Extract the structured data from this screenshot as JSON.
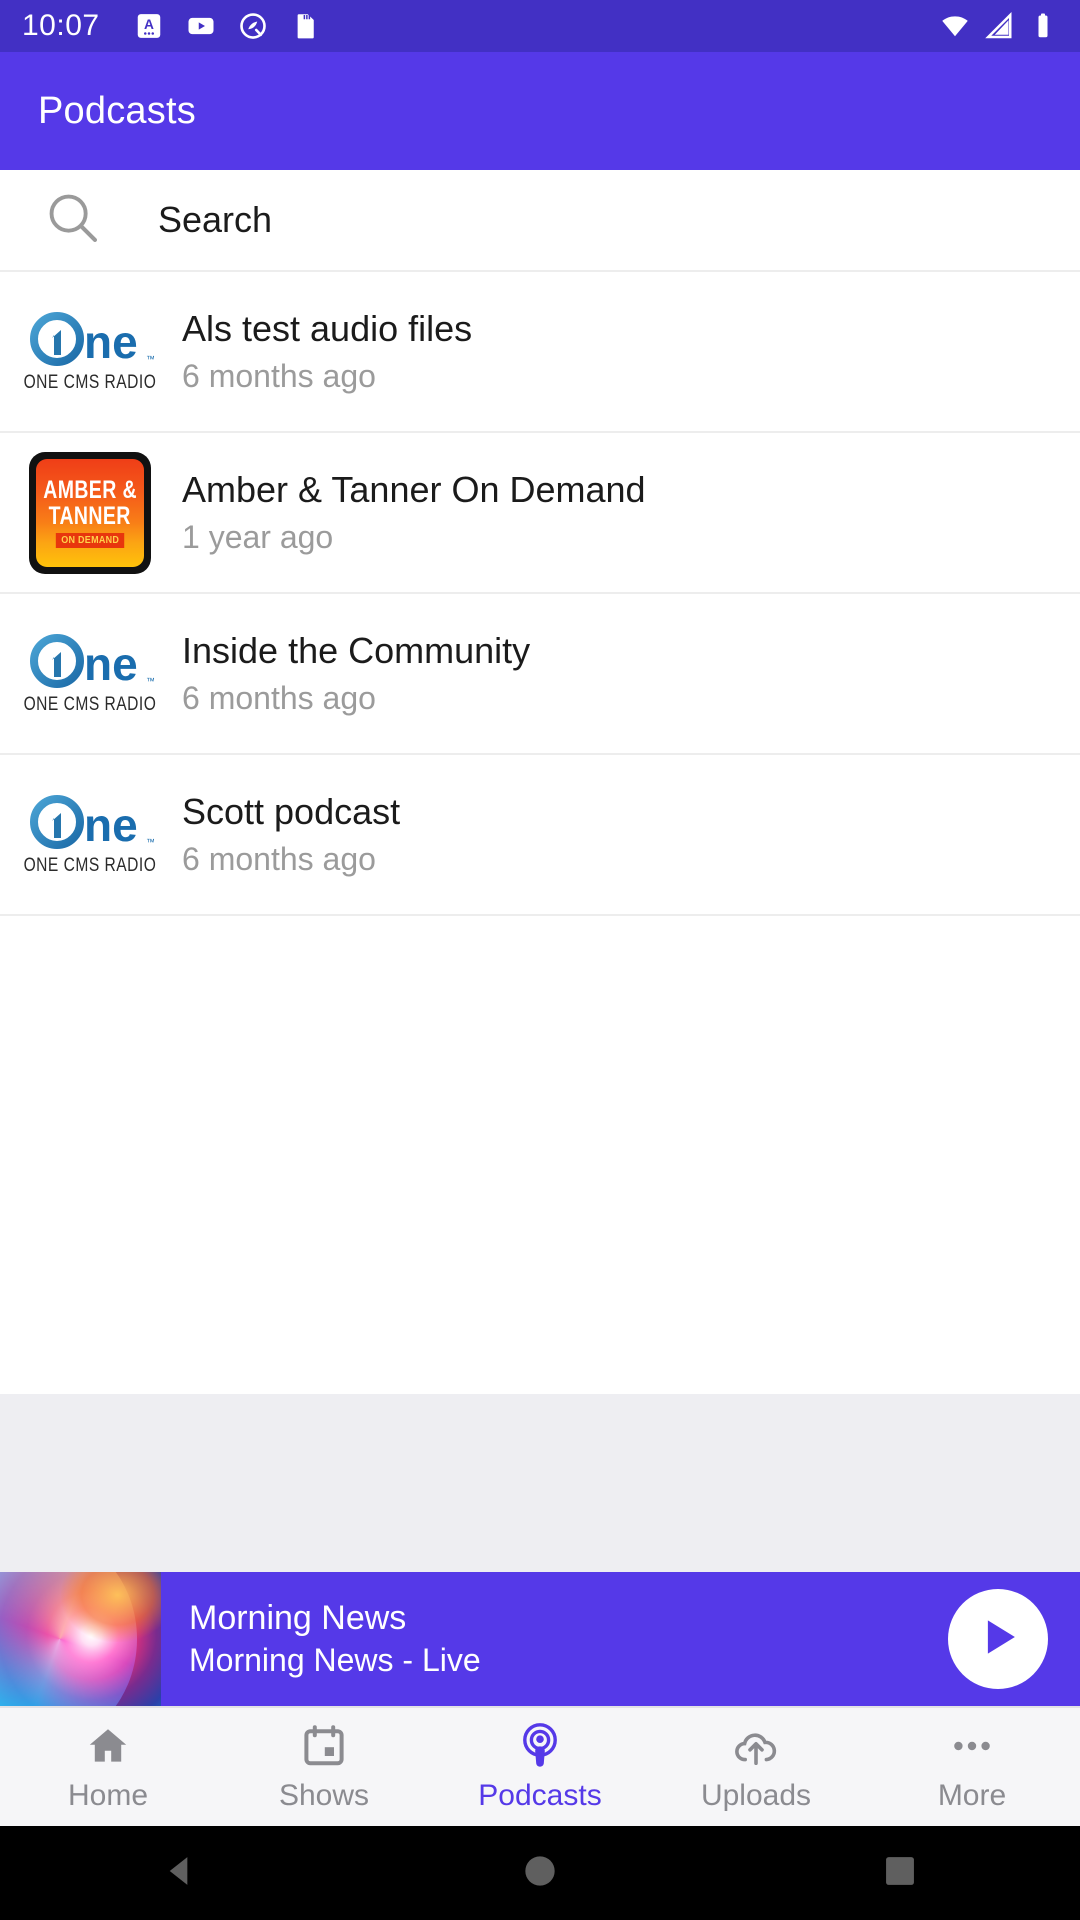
{
  "status_bar": {
    "time": "10:07",
    "left_icons": [
      "a-badge-icon",
      "youtube-icon",
      "q-circle-icon",
      "sd-card-icon"
    ],
    "right_icons": [
      "wifi-icon",
      "cellular-signal-icon",
      "battery-icon"
    ]
  },
  "app_bar": {
    "title": "Podcasts",
    "background": "#5539e8"
  },
  "search": {
    "label": "Search",
    "icon": "search-icon"
  },
  "podcasts": [
    {
      "title": "Als test audio files",
      "subtitle": "6 months ago",
      "artwork": "one-cms-radio-logo",
      "artwork_caption": "ONE CMS RADIO",
      "logo_text": "ne"
    },
    {
      "title": "Amber & Tanner On Demand",
      "subtitle": "1 year ago",
      "artwork": "amber-tanner-artwork",
      "art_line1": "AMBER &",
      "art_line2": "TANNER",
      "art_badge": "ON DEMAND"
    },
    {
      "title": "Inside the Community",
      "subtitle": "6 months ago",
      "artwork": "one-cms-radio-logo",
      "artwork_caption": "ONE CMS RADIO",
      "logo_text": "ne"
    },
    {
      "title": "Scott podcast",
      "subtitle": "6 months ago",
      "artwork": "one-cms-radio-logo",
      "artwork_caption": "ONE CMS RADIO",
      "logo_text": "ne"
    }
  ],
  "now_playing": {
    "title": "Morning News",
    "subtitle": "Morning News - Live",
    "play_icon": "play-icon",
    "artwork": "morning-news-swirl-artwork",
    "background": "#5539e8"
  },
  "bottom_nav": {
    "active": "Podcasts",
    "accent": "#5539e8",
    "inactive_color": "#8b8b90",
    "items": [
      {
        "label": "Home",
        "icon": "home-icon"
      },
      {
        "label": "Shows",
        "icon": "calendar-icon"
      },
      {
        "label": "Podcasts",
        "icon": "podcast-icon"
      },
      {
        "label": "Uploads",
        "icon": "cloud-upload-icon"
      },
      {
        "label": "More",
        "icon": "more-dots-icon"
      }
    ]
  },
  "system_nav": {
    "items": [
      "back-icon",
      "home-circle-icon",
      "recents-square-icon"
    ]
  }
}
